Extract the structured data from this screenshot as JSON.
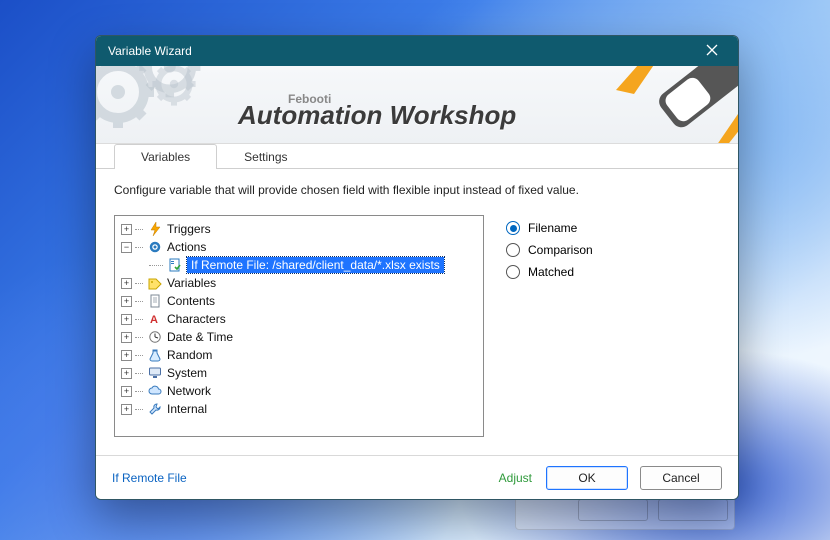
{
  "window": {
    "title": "Variable Wizard"
  },
  "banner": {
    "sub": "Febooti",
    "brand": "Automation Workshop"
  },
  "tabs": {
    "variables": "Variables",
    "settings": "Settings"
  },
  "instruction": "Configure variable that will provide chosen field with flexible input instead of fixed value.",
  "tree": {
    "triggers": "Triggers",
    "actions": "Actions",
    "action_child": "If Remote File: /shared/client_data/*.xlsx exists",
    "variables": "Variables",
    "contents": "Contents",
    "characters": "Characters",
    "datetime": "Date & Time",
    "random": "Random",
    "system": "System",
    "network": "Network",
    "internal": "Internal"
  },
  "radios": {
    "filename": "Filename",
    "comparison": "Comparison",
    "matched": "Matched"
  },
  "footer": {
    "link": "If Remote File",
    "adjust": "Adjust",
    "ok": "OK",
    "cancel": "Cancel"
  }
}
